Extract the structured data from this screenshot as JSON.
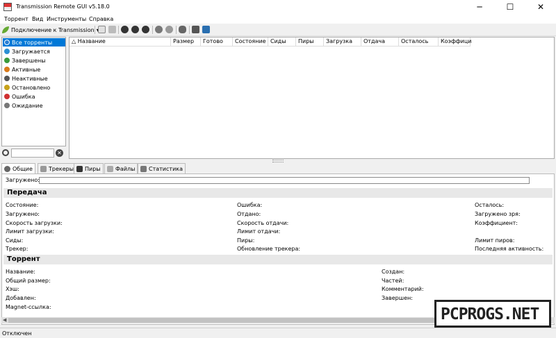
{
  "window": {
    "title": "Transmission Remote GUI v5.18.0",
    "minimize": "─",
    "maximize": "☐",
    "close": "✕"
  },
  "menu": [
    "Торрент",
    "Вид",
    "Инструменты",
    "Справка"
  ],
  "toolbar": {
    "connect_label": "Подключение к Transmission",
    "dropdown_glyph": "▾"
  },
  "sidebar": {
    "items": [
      {
        "label": "Все торренты",
        "color": "#2a7fd4"
      },
      {
        "label": "Загружается",
        "color": "#2a8fd4"
      },
      {
        "label": "Завершены",
        "color": "#3a9a3a"
      },
      {
        "label": "Активные",
        "color": "#d97a1a"
      },
      {
        "label": "Неактивные",
        "color": "#555555"
      },
      {
        "label": "Остановлено",
        "color": "#c7a21a"
      },
      {
        "label": "Ошибка",
        "color": "#d03030"
      },
      {
        "label": "Ожидание",
        "color": "#777777"
      }
    ],
    "clear_glyph": "✕"
  },
  "columns": [
    "△ Название",
    "Размер",
    "Готово",
    "Состояние",
    "Сиды",
    "Пиры",
    "Загрузка",
    "Отдача",
    "Осталось",
    "Коэффици"
  ],
  "tabs": [
    "Общие",
    "Трекеры",
    "Пиры",
    "Файлы",
    "Статистика"
  ],
  "details": {
    "downloaded_label": "Загружено:",
    "transfer_title": "Передача",
    "transfer": [
      [
        "Состояние:",
        "Ошибка:",
        "Осталось:"
      ],
      [
        "Загружено:",
        "Отдано:",
        "Загружено зря:"
      ],
      [
        "Скорость загрузки:",
        "Скорость отдачи:",
        "Коэффициент:"
      ],
      [
        "Лимит загрузки:",
        "Лимит отдачи:",
        ""
      ],
      [
        "Сиды:",
        "Пиры:",
        "Лимит пиров:"
      ],
      [
        "Трекер:",
        "Обновление трекера:",
        "Последняя активность:"
      ]
    ],
    "torrent_title": "Торрент",
    "torrent": [
      [
        "Название:",
        "Создан:"
      ],
      [
        "Общий размер:",
        "Частей:"
      ],
      [
        "Хэш:",
        "Комментарий:"
      ],
      [
        "Добавлен:",
        "Завершен:"
      ],
      [
        "Magnet-ссылка:",
        ""
      ]
    ]
  },
  "status": "Отключен",
  "watermark": "PCPROGS.NET",
  "colors": {
    "selection": "#0078d7"
  }
}
